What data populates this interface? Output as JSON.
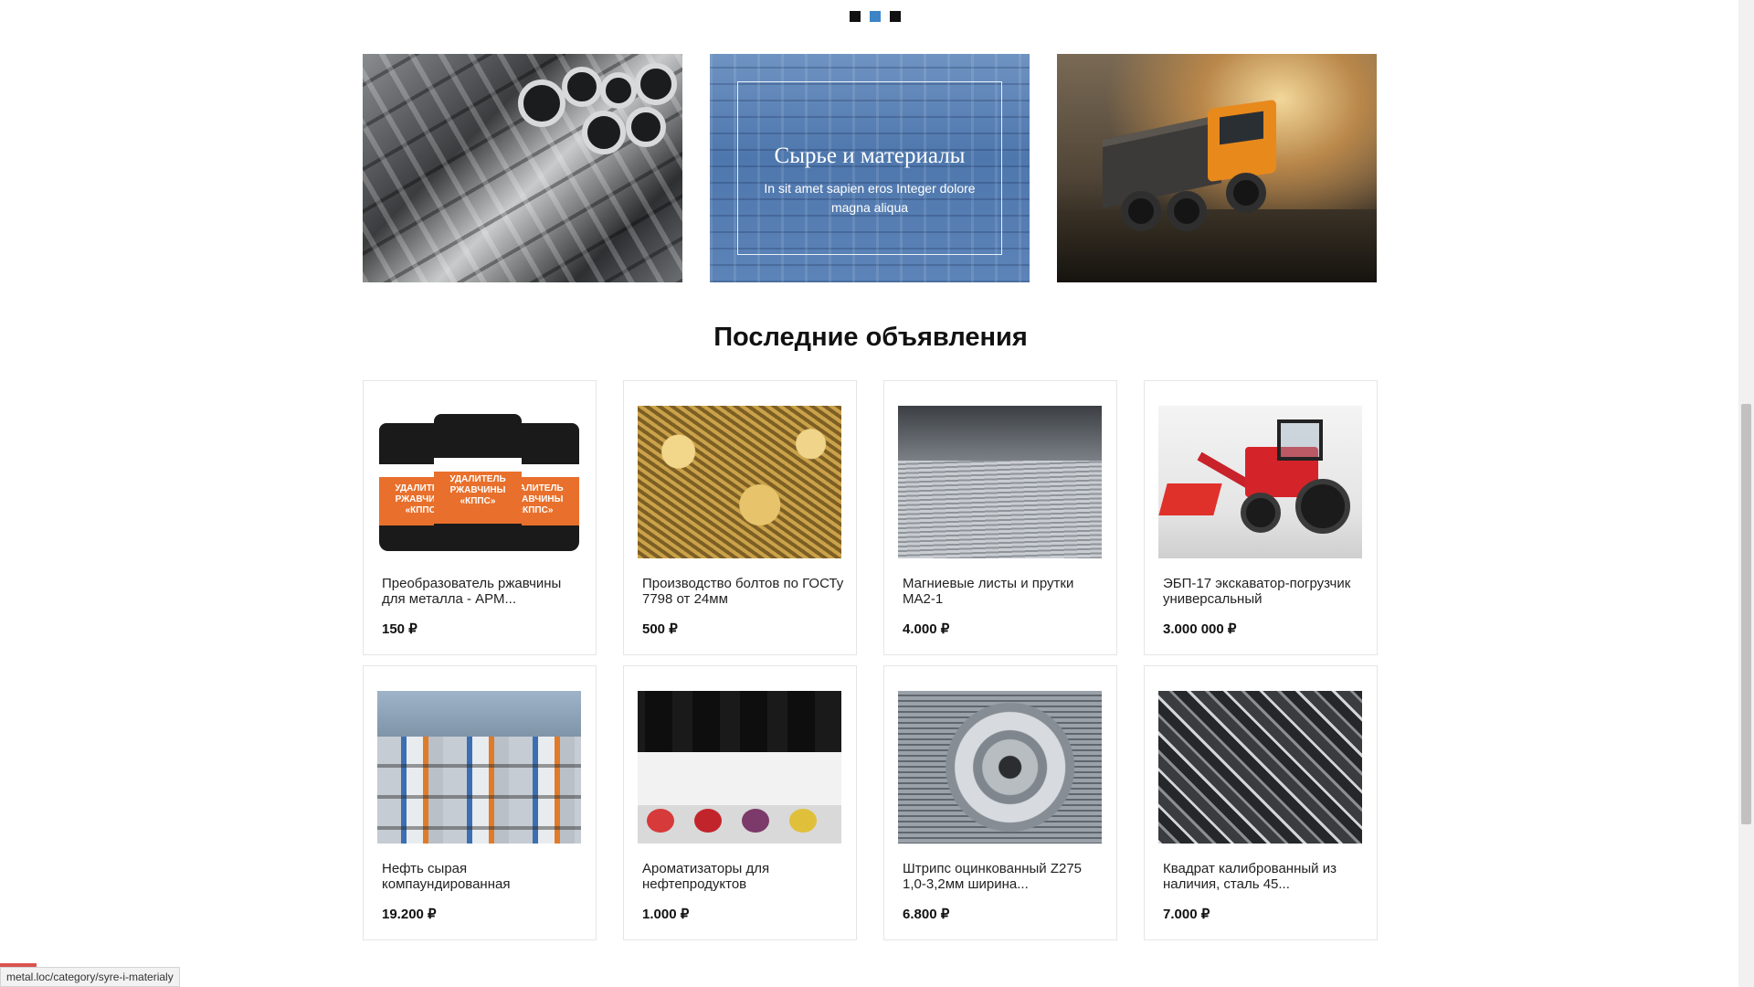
{
  "slider": {
    "dots": [
      {
        "label": "slide-1",
        "active": false
      },
      {
        "label": "slide-2",
        "active": true
      },
      {
        "label": "slide-3",
        "active": false
      }
    ],
    "active_color": "#3d84c6"
  },
  "banners": {
    "center": {
      "title": "Сырье и материалы",
      "subtitle": "In sit amet sapien eros Integer dolore magna aliqua"
    }
  },
  "section": {
    "title": "Последние объявления"
  },
  "products": [
    {
      "name": "Преобразователь ржавчины для металла - АРМ...",
      "price": "150 ₽",
      "image": "rust-remover-jars"
    },
    {
      "name": "Производство болтов по ГОСТу 7798 от 24мм",
      "price": "500 ₽",
      "image": "brass-bolts"
    },
    {
      "name": "Магниевые листы и прутки МА2-1",
      "price": "4.000 ₽",
      "image": "metal-sheets"
    },
    {
      "name": "ЭБП-17 экскаватор-погрузчик универсальный",
      "price": "3.000 000 ₽",
      "image": "red-tractor-loader"
    },
    {
      "name": "Нефть сырая компаундированная",
      "price": "19.200 ₽",
      "image": "oil-barrels"
    },
    {
      "name": "Ароматизаторы для нефтепродуктов",
      "price": "1.000 ₽",
      "image": "flavor-bottles"
    },
    {
      "name": "Штрипс оцинкованный Z275 1,0-3,2мм ширина...",
      "price": "6.800 ₽",
      "image": "steel-coil"
    },
    {
      "name": "Квадрат калиброванный из наличия, сталь 45...",
      "price": "7.000 ₽",
      "image": "steel-angle-profiles"
    }
  ],
  "jar_label": "УДАЛИТЕЛЬ РЖАВЧИНЫ «КППС»",
  "status_bar": {
    "url": "metal.loc/category/syre-i-materialy"
  }
}
